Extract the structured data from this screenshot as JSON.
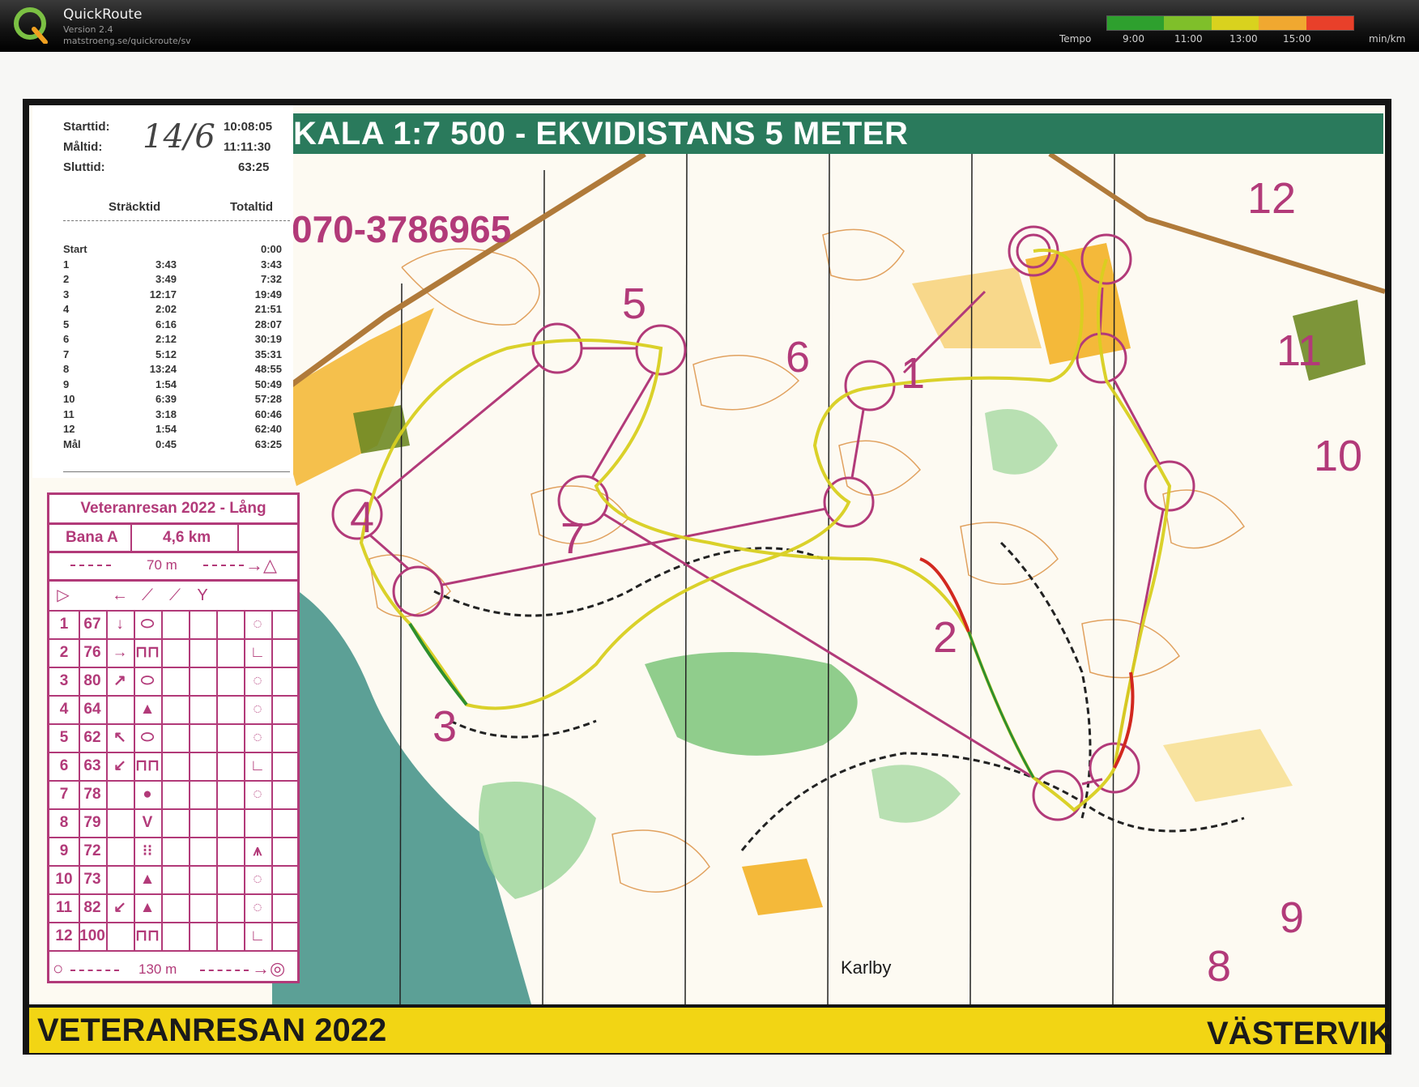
{
  "app": {
    "name": "QuickRoute",
    "version": "Version 2.4",
    "url": "matstroeng.se/quickroute/sv"
  },
  "tempo_legend": {
    "label": "Tempo",
    "ticks": [
      "9:00",
      "11:00",
      "13:00",
      "15:00"
    ],
    "unit": "min/km",
    "colors": [
      "#2ea02e",
      "#7fbf2a",
      "#d9d21e",
      "#f0a830",
      "#e8402a"
    ]
  },
  "map": {
    "scale_banner": "KALA 1:7 500 - EKVIDISTANS 5 METER",
    "phone": "070-3786965",
    "event_title": "VETERANRESAN 2022",
    "event_place": "VÄSTERVIK",
    "place_label": "Karlby",
    "handwritten_date": "14/6",
    "control_numbers": [
      "1",
      "2",
      "3",
      "4",
      "5",
      "6",
      "7",
      "8",
      "9",
      "10",
      "11",
      "12"
    ]
  },
  "splits": {
    "start_time_label": "Starttid:",
    "start_time": "10:08:05",
    "finish_time_label": "Måltid:",
    "finish_time": "11:11:30",
    "total_time_label": "Sluttid:",
    "total_time": "63:25",
    "col_split": "Sträcktid",
    "col_total": "Totaltid",
    "rows": [
      {
        "leg": "Start",
        "split": "",
        "total": "0:00"
      },
      {
        "leg": "1",
        "split": "3:43",
        "total": "3:43"
      },
      {
        "leg": "2",
        "split": "3:49",
        "total": "7:32"
      },
      {
        "leg": "3",
        "split": "12:17",
        "total": "19:49"
      },
      {
        "leg": "4",
        "split": "2:02",
        "total": "21:51"
      },
      {
        "leg": "5",
        "split": "6:16",
        "total": "28:07"
      },
      {
        "leg": "6",
        "split": "2:12",
        "total": "30:19"
      },
      {
        "leg": "7",
        "split": "5:12",
        "total": "35:31"
      },
      {
        "leg": "8",
        "split": "13:24",
        "total": "48:55"
      },
      {
        "leg": "9",
        "split": "1:54",
        "total": "50:49"
      },
      {
        "leg": "10",
        "split": "6:39",
        "total": "57:28"
      },
      {
        "leg": "11",
        "split": "3:18",
        "total": "60:46"
      },
      {
        "leg": "12",
        "split": "1:54",
        "total": "62:40"
      },
      {
        "leg": "Mål",
        "split": "0:45",
        "total": "63:25"
      }
    ]
  },
  "control_description": {
    "title": "Veteranresan 2022 - Lång",
    "course": "Bana A",
    "length": "4,6 km",
    "start_marking": "70 m",
    "finish_marking": "130 m",
    "rows": [
      {
        "n": "1",
        "code": "67",
        "dir": "↓",
        "feat": "⬭",
        "pos": "◌"
      },
      {
        "n": "2",
        "code": "76",
        "dir": "→",
        "feat": "⊓⊓",
        "pos": "∟"
      },
      {
        "n": "3",
        "code": "80",
        "dir": "↗",
        "feat": "⬭",
        "pos": "◌"
      },
      {
        "n": "4",
        "code": "64",
        "dir": "",
        "feat": "▲",
        "pos": "◌"
      },
      {
        "n": "5",
        "code": "62",
        "dir": "↖",
        "feat": "⬭",
        "pos": "◌"
      },
      {
        "n": "6",
        "code": "63",
        "dir": "↙",
        "feat": "⊓⊓",
        "pos": "∟"
      },
      {
        "n": "7",
        "code": "78",
        "dir": "",
        "feat": "●",
        "pos": "◌"
      },
      {
        "n": "8",
        "code": "79",
        "dir": "",
        "feat": "V",
        "pos": ""
      },
      {
        "n": "9",
        "code": "72",
        "dir": "",
        "feat": "⁝⁝",
        "pos": "⩚"
      },
      {
        "n": "10",
        "code": "73",
        "dir": "",
        "feat": "▲",
        "pos": "◌"
      },
      {
        "n": "11",
        "code": "82",
        "dir": "↙",
        "feat": "▲",
        "pos": "◌"
      },
      {
        "n": "12",
        "code": "100",
        "dir": "",
        "feat": "⊓⊓",
        "pos": "∟"
      }
    ]
  }
}
